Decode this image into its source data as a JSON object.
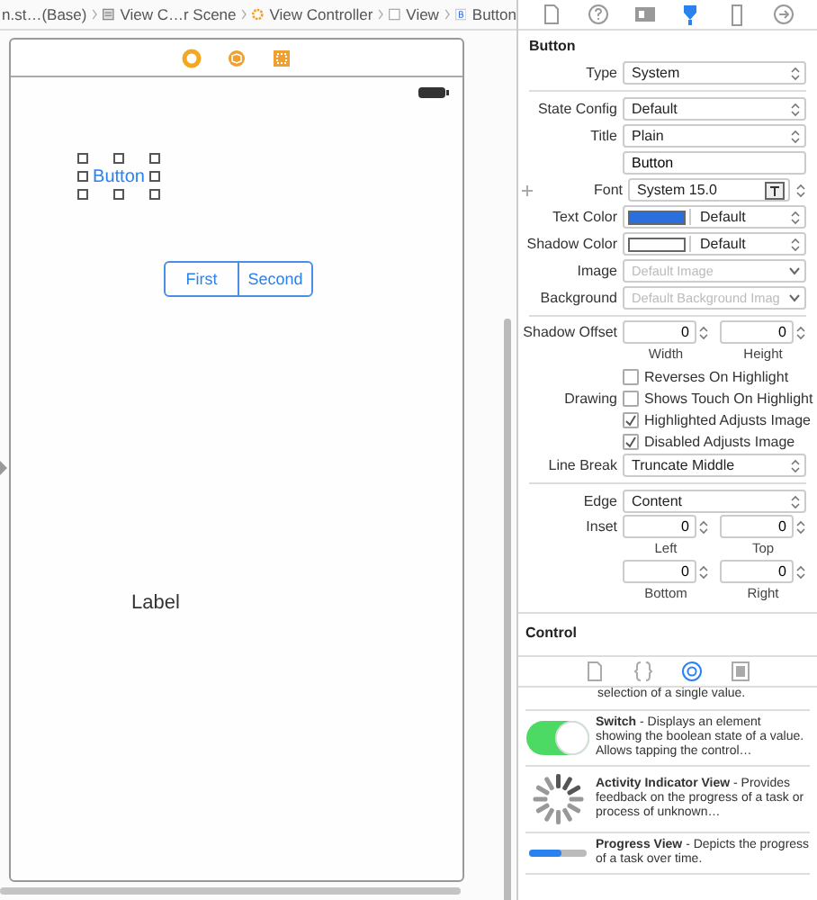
{
  "breadcrumb": [
    {
      "kind": "file",
      "label": "n.st…(Base)"
    },
    {
      "kind": "scene",
      "label": "View C…r Scene"
    },
    {
      "kind": "controller",
      "label": "View Controller"
    },
    {
      "kind": "view",
      "label": "View"
    },
    {
      "kind": "button",
      "label": "Button"
    }
  ],
  "canvas": {
    "button": {
      "label": "Button",
      "selected": true
    },
    "segmented": [
      {
        "label": "First"
      },
      {
        "label": "Second"
      }
    ],
    "label": "Label"
  },
  "inspector_tabs": [
    {
      "selected": false
    },
    {
      "selected": false
    },
    {
      "selected": false
    },
    {
      "selected": true
    },
    {
      "selected": false
    },
    {
      "selected": false
    }
  ],
  "inspector": {
    "title": "Button",
    "rows": [
      {
        "kind": "select",
        "label": "Type",
        "value": "System"
      },
      {
        "kind": "divider"
      },
      {
        "kind": "select",
        "label": "State Config",
        "value": "Default"
      },
      {
        "kind": "select",
        "label": "Title",
        "value": "Plain"
      },
      {
        "kind": "text",
        "value": "Button"
      },
      {
        "kind": "font",
        "label": "Font",
        "value": "System 15.0"
      },
      {
        "kind": "color",
        "label": "Text Color",
        "color": "#2a6fdb",
        "value": "Default"
      },
      {
        "kind": "color",
        "label": "Shadow Color",
        "color": "#ffffff",
        "value": "Default"
      },
      {
        "kind": "image",
        "label": "Image",
        "placeholder": "Default Image"
      },
      {
        "kind": "image",
        "label": "Background",
        "placeholder": "Default Background Imag"
      },
      {
        "kind": "divider"
      },
      {
        "kind": "pair",
        "label": "Shadow Offset",
        "fields": [
          {
            "value": "0",
            "caption": "Width"
          },
          {
            "value": "0",
            "caption": "Height"
          }
        ]
      },
      {
        "kind": "check",
        "label": "",
        "text": "Reverses On Highlight",
        "checked": false
      },
      {
        "kind": "check",
        "label": "Drawing",
        "text": "Shows Touch On Highlight",
        "checked": false
      },
      {
        "kind": "check",
        "label": "",
        "text": "Highlighted Adjusts Image",
        "checked": true
      },
      {
        "kind": "check",
        "label": "",
        "text": "Disabled Adjusts Image",
        "checked": true
      },
      {
        "kind": "select",
        "label": "Line Break",
        "value": "Truncate Middle"
      },
      {
        "kind": "divider"
      },
      {
        "kind": "select",
        "label": "Edge",
        "value": "Content"
      },
      {
        "kind": "pair",
        "label": "Inset",
        "fields": [
          {
            "value": "0",
            "caption": "Left"
          },
          {
            "value": "0",
            "caption": "Top"
          }
        ]
      },
      {
        "kind": "pair",
        "label": "",
        "fields": [
          {
            "value": "0",
            "caption": "Bottom"
          },
          {
            "value": "0",
            "caption": "Right"
          }
        ]
      }
    ],
    "next_section": "Control"
  },
  "library_tabs": [
    {
      "selected": false
    },
    {
      "selected": false
    },
    {
      "selected": true
    },
    {
      "selected": false
    }
  ],
  "library": [
    {
      "kind": "partial",
      "text": "selection of a single value."
    },
    {
      "kind": "switch",
      "text": "**Switch** - Displays an element showing the boolean state of a value. Allows tapping the control…"
    },
    {
      "kind": "activity",
      "text": "**Activity Indicator View** - Provides feedback on the progress of a task or process of unknown…"
    },
    {
      "kind": "progress",
      "text": "**Progress View** - Depicts the progress of a task over time.",
      "level": 0.55
    }
  ]
}
